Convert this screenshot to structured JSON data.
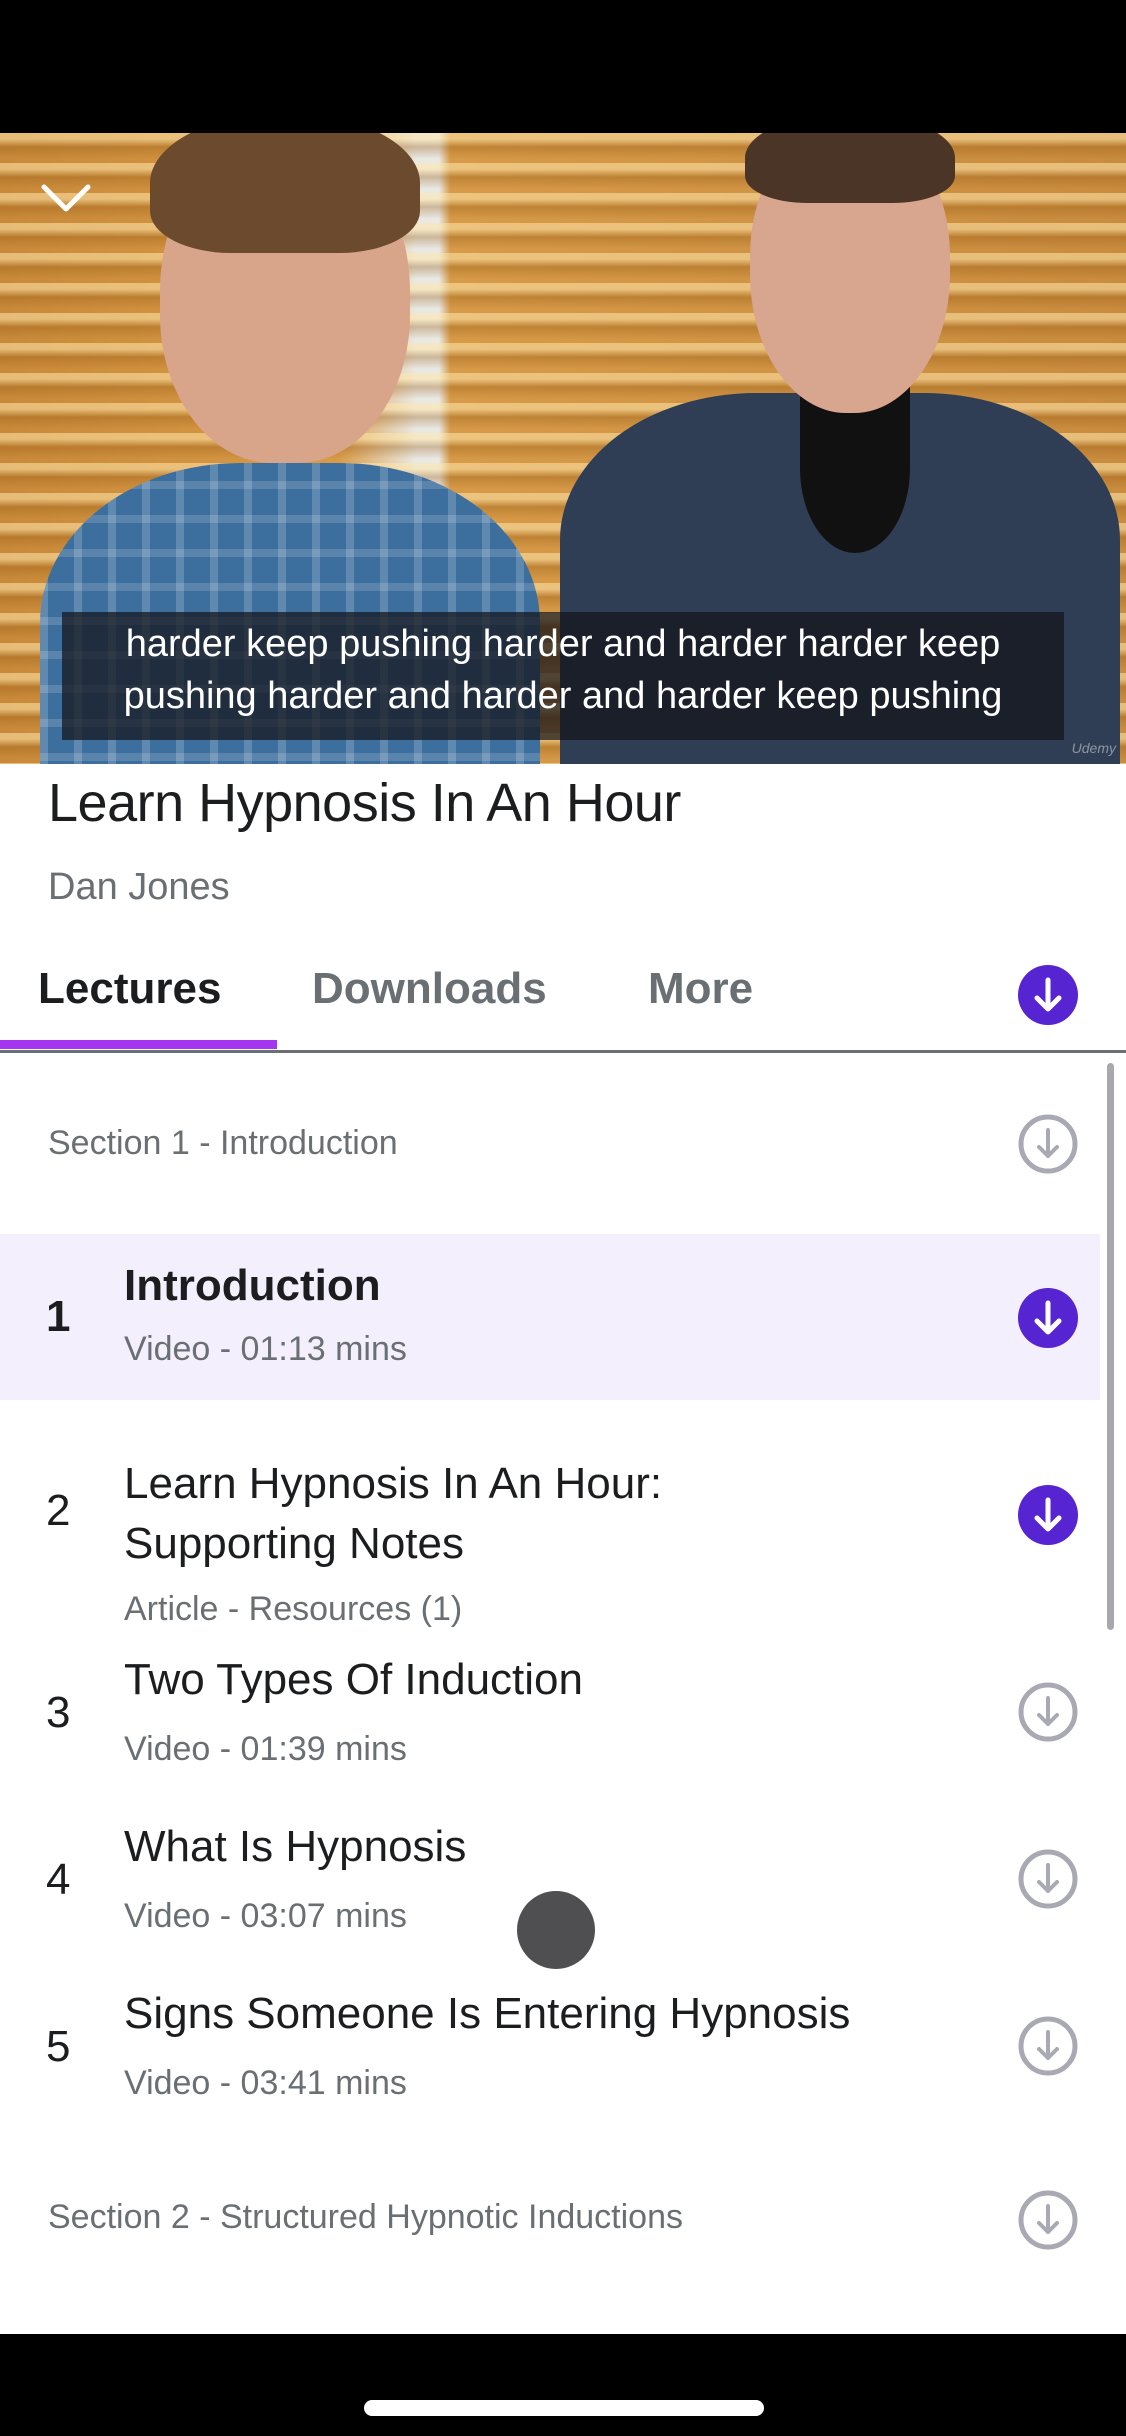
{
  "video": {
    "subtitle_lines": [
      "harder keep pushing harder and harder harder keep",
      "pushing harder and harder and harder keep pushing"
    ],
    "watermark": "Udemy",
    "collapse_icon": "chevron-down-icon"
  },
  "course": {
    "title": "Learn Hypnosis In An Hour",
    "instructor": "Dan Jones"
  },
  "tabs": [
    {
      "label": "Lectures",
      "active": true
    },
    {
      "label": "Downloads",
      "active": false
    },
    {
      "label": "More",
      "active": false
    }
  ],
  "download_all_icon": "download-circle-filled-icon",
  "colors": {
    "accent_purple": "#5624d0",
    "tab_underline": "#a435f0",
    "current_row_bg": "#f3effc",
    "text_primary": "#1c1d1f",
    "text_secondary": "#6a6f73",
    "icon_inactive": "#a9a9b3"
  },
  "curriculum": {
    "sections": [
      {
        "title": "Section 1 - Introduction",
        "downloaded": false,
        "lectures": [
          {
            "number": "1",
            "title": "Introduction",
            "meta": "Video - 01:13 mins",
            "current": true,
            "downloaded": true
          },
          {
            "number": "2",
            "title_lines": [
              "Learn Hypnosis In An Hour:",
              "Supporting Notes"
            ],
            "title": "Learn Hypnosis In An Hour: Supporting Notes",
            "meta": "Article - Resources (1)",
            "current": false,
            "downloaded": true
          },
          {
            "number": "3",
            "title": "Two Types Of Induction",
            "meta": "Video - 01:39 mins",
            "current": false,
            "downloaded": false
          },
          {
            "number": "4",
            "title": "What Is Hypnosis",
            "meta": "Video - 03:07 mins",
            "current": false,
            "downloaded": false
          },
          {
            "number": "5",
            "title": "Signs Someone Is Entering Hypnosis",
            "meta": "Video - 03:41 mins",
            "current": false,
            "downloaded": false
          }
        ]
      },
      {
        "title": "Section 2 - Structured Hypnotic Inductions",
        "downloaded": false,
        "lectures": []
      }
    ]
  }
}
